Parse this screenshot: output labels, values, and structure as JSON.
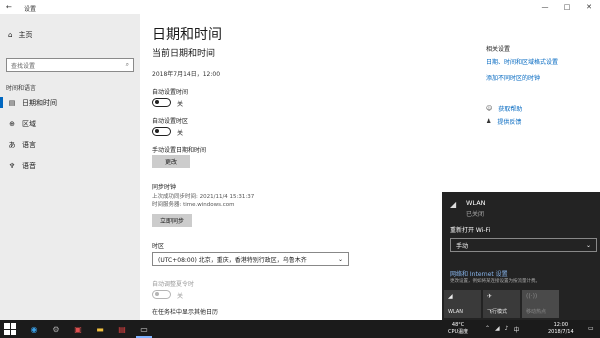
{
  "window": {
    "title": "设置",
    "back_icon": "back-arrow-icon",
    "minimize": "—",
    "maximize": "□",
    "close": "✕"
  },
  "sidebar": {
    "home": "主页",
    "search_placeholder": "查找设置",
    "section": "时间和语言",
    "items": [
      {
        "label": "日期和时间",
        "icon": "calendar-clock-icon",
        "active": true
      },
      {
        "label": "区域",
        "icon": "globe-icon",
        "active": false
      },
      {
        "label": "语言",
        "icon": "language-icon",
        "active": false
      },
      {
        "label": "语音",
        "icon": "microphone-icon",
        "active": false
      }
    ]
  },
  "main": {
    "title": "日期和时间",
    "subtitle": "当前日期和时间",
    "current_datetime": "2018年7月14日，12:00",
    "auto_time_label": "自动设置时间",
    "auto_time_state": "关",
    "auto_zone_label": "自动设置时区",
    "auto_zone_state": "关",
    "manual_label": "手动设置日期和时间",
    "change_button": "更改",
    "sync_title": "同步时钟",
    "last_sync": "上次成功同步时间: 2021/11/4 15:31:37",
    "time_server": "时间服务器: time.windows.com",
    "sync_button": "立即同步",
    "timezone_label": "时区",
    "timezone_value": "(UTC+08:00) 北京，重庆，香港特别行政区，乌鲁木齐",
    "dst_label": "自动调整夏令时",
    "dst_state": "关",
    "calendar_label": "在任务栏中显示其他日历"
  },
  "related": {
    "title": "相关设置",
    "links": [
      "日期、时间和区域格式设置",
      "添加不同时区的时钟"
    ],
    "help": "获取帮助",
    "feedback": "提供反馈"
  },
  "flyout": {
    "wlan": "WLAN",
    "wlan_state": "已关闭",
    "reopen_label": "重新打开 Wi-Fi",
    "reopen_value": "手动",
    "net_link": "网络和 Internet 设置",
    "net_desc": "更改设置，例如将某连接设置为按流量计费。",
    "tiles": [
      {
        "label": "WLAN",
        "icon": "wifi-icon",
        "dim": false
      },
      {
        "label": "飞行模式",
        "icon": "airplane-icon",
        "dim": false
      },
      {
        "label": "移动热点",
        "icon": "hotspot-icon",
        "dim": true
      }
    ]
  },
  "taskbar": {
    "temp": "48°C",
    "cpu": "CPU温度",
    "ime": "中",
    "time": "12:00",
    "date": "2018/7/14"
  },
  "colors": {
    "accent": "#0067c0",
    "sidebar_bg": "#ececec",
    "flyout_bg": "#232323",
    "taskbar_bg": "#1b1b1b"
  }
}
